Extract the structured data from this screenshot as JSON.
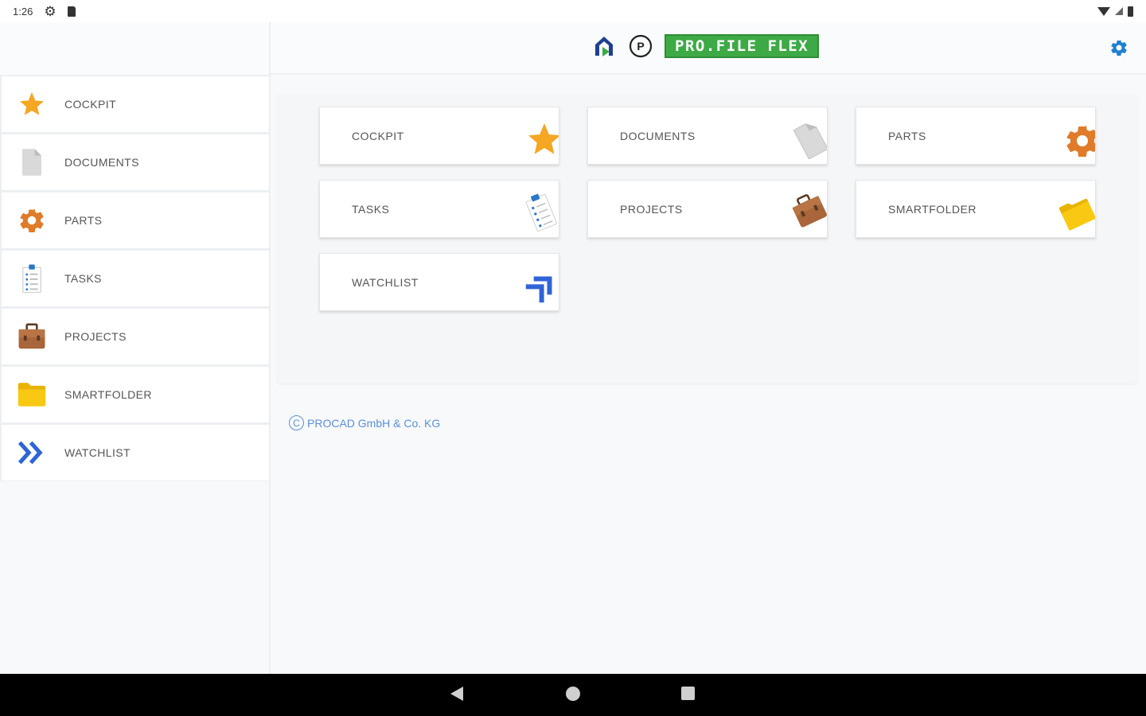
{
  "status": {
    "time": "1:26"
  },
  "header": {
    "brand_name": "PRO.FILE FLEX"
  },
  "sidebar": {
    "items": [
      {
        "label": "COCKPIT"
      },
      {
        "label": "DOCUMENTS"
      },
      {
        "label": "PARTS"
      },
      {
        "label": "TASKS"
      },
      {
        "label": "PROJECTS"
      },
      {
        "label": "SMARTFOLDER"
      },
      {
        "label": "WATCHLIST"
      }
    ]
  },
  "tiles": [
    {
      "label": "COCKPIT"
    },
    {
      "label": "DOCUMENTS"
    },
    {
      "label": "PARTS"
    },
    {
      "label": "TASKS"
    },
    {
      "label": "PROJECTS"
    },
    {
      "label": "SMARTFOLDER"
    },
    {
      "label": "WATCHLIST"
    }
  ],
  "footer": {
    "copyright": "PROCAD GmbH & Co. KG",
    "copy_symbol": "C"
  },
  "colors": {
    "accent": "#3daa45",
    "link": "#5a8fd6",
    "star": "#f5a623",
    "gear": "#e07b2a",
    "watchlist": "#2f63d8"
  }
}
